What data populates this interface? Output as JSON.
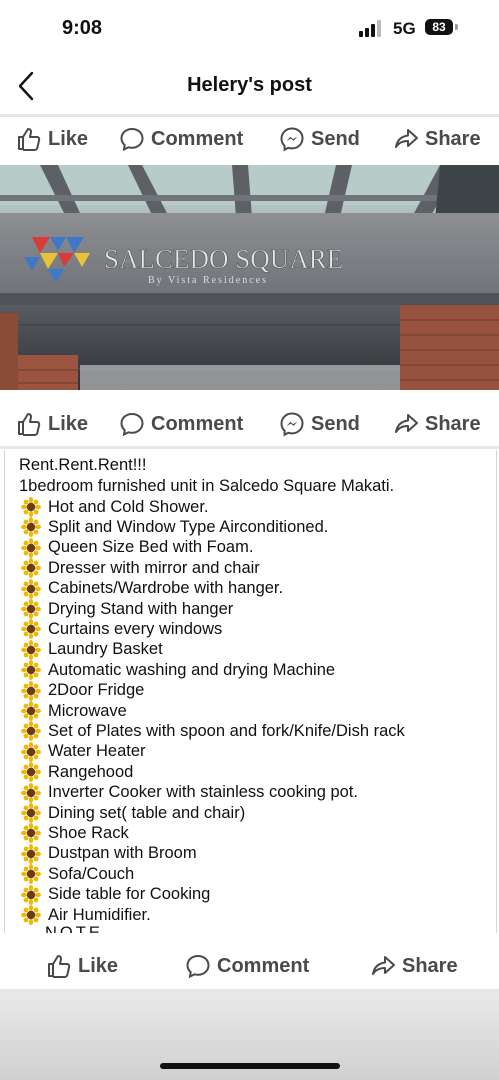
{
  "status": {
    "time": "9:08",
    "network": "5G",
    "battery": "83"
  },
  "header": {
    "title": "Helery's post"
  },
  "actions": {
    "like": "Like",
    "comment": "Comment",
    "send": "Send",
    "share": "Share"
  },
  "photo": {
    "sign_text": "SALCEDO SQUARE",
    "sign_subtext": "By Vista Residences"
  },
  "post": {
    "heading": "Rent.Rent.Rent!!!",
    "intro": "1bedroom furnished unit in Salcedo Square Makati.",
    "items": [
      "Hot and Cold Shower.",
      "Split and Window Type Airconditioned.",
      "Queen Size Bed with Foam.",
      "Dresser with mirror and chair",
      "Cabinets/Wardrobe with hanger.",
      "Drying Stand with hanger",
      "Curtains every windows",
      "Laundry Basket",
      "Automatic washing and drying Machine",
      "2Door Fridge",
      "Microwave",
      "Set of Plates with spoon and fork/Knife/Dish rack",
      "Water Heater",
      "Rangehood",
      "Inverter Cooker with stainless cooking  pot.",
      "Dining set( table and chair)",
      "Shoe Rack",
      "Dustpan with Broom",
      "Sofa/Couch",
      "Side table for Cooking",
      "Air Humidifier."
    ],
    "cutoff": "NOTE"
  },
  "icons": {
    "like": "thumbs-up-icon",
    "comment": "comment-bubble-icon",
    "send": "messenger-icon",
    "share": "share-arrow-icon",
    "item": "sunflower-icon"
  }
}
